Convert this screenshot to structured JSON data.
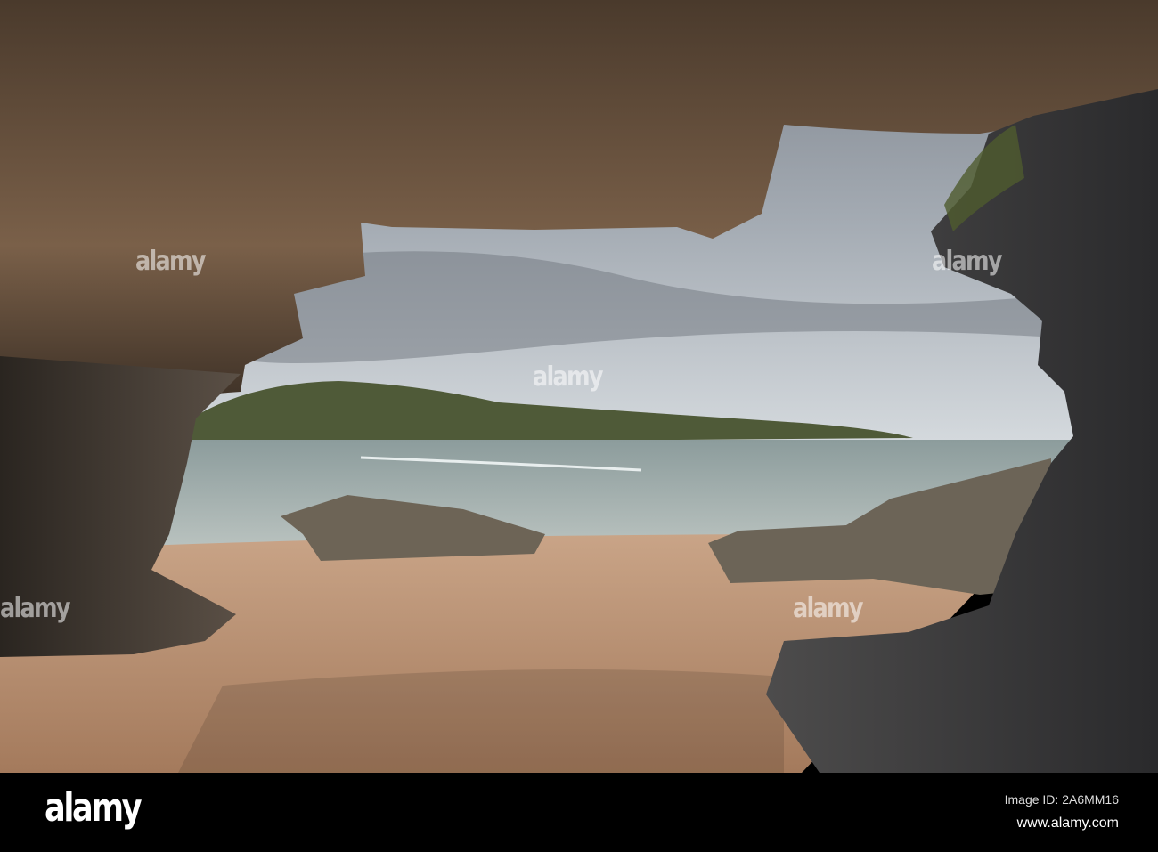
{
  "photo": {
    "subject": "sea cave view of sandy beach and headland",
    "watermark_text": "alamy"
  },
  "footer": {
    "logo": "alamy",
    "image_id": "Image ID: 2A6MM16",
    "website": "www.alamy.com"
  }
}
